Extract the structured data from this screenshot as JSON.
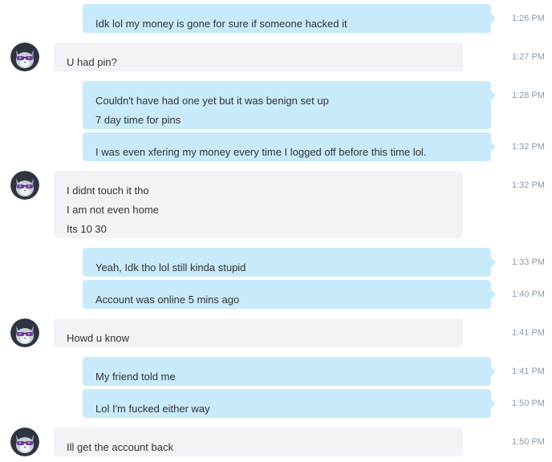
{
  "contact_avatar_icon": "cat-with-sunglasses-avatar",
  "colors": {
    "outgoing_bubble": "#c8eafb",
    "incoming_bubble": "#f1f3f6",
    "timestamp": "#8a9aa6",
    "text": "#333333"
  },
  "messages": [
    {
      "direction": "out",
      "time": "1:26 PM",
      "lines": [
        "Idk lol my money is gone for sure if someone hacked it"
      ]
    },
    {
      "direction": "in",
      "time": "1:27 PM",
      "lines": [
        "U had pin?"
      ]
    },
    {
      "direction": "out",
      "time": "1:28 PM",
      "lines": [
        "Couldn't have had one yet but it was benign set up",
        "7 day time for pins"
      ]
    },
    {
      "direction": "out",
      "time": "1:32 PM",
      "lines": [
        "I was even xfering my money every time I logged off before this time lol."
      ]
    },
    {
      "direction": "in",
      "time": "1:32 PM",
      "lines": [
        "I didnt touch it tho",
        "I am not even home",
        "Its 10 30"
      ]
    },
    {
      "direction": "out",
      "time": "1:33 PM",
      "lines": [
        "Yeah, Idk tho lol still kinda stupid"
      ]
    },
    {
      "direction": "out",
      "time": "1:40 PM",
      "lines": [
        "Account was online 5 mins ago"
      ]
    },
    {
      "direction": "in",
      "time": "1:41 PM",
      "lines": [
        "Howd u know"
      ]
    },
    {
      "direction": "out",
      "time": "1:41 PM",
      "lines": [
        "My friend told me"
      ]
    },
    {
      "direction": "out",
      "time": "1:50 PM",
      "lines": [
        "Lol I'm fucked either way"
      ]
    },
    {
      "direction": "in",
      "time": "1:50 PM",
      "lines": [
        "Ill get the account back"
      ]
    }
  ]
}
